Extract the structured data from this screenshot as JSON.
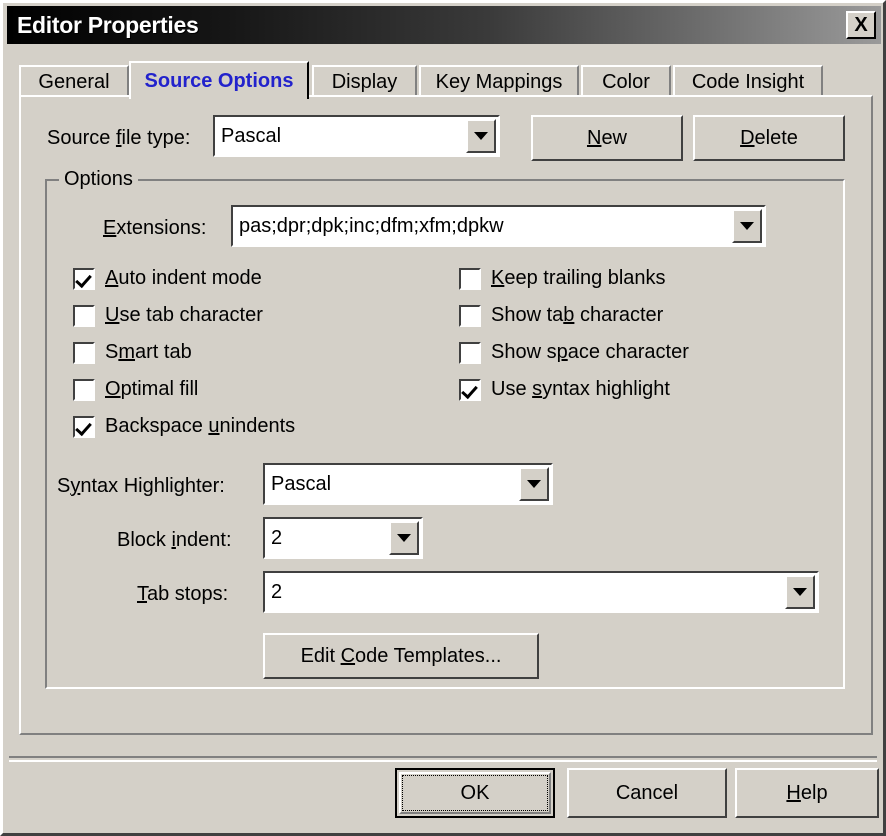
{
  "window": {
    "title": "Editor Properties",
    "close_label": "X",
    "titlebar_gradient_from": "#000000",
    "titlebar_gradient_to": "#9a9a9a",
    "face_color": "#d4d0c8",
    "active_tab_color": "#2222cc"
  },
  "tabs": [
    {
      "label": "General",
      "active": false
    },
    {
      "label": "Source Options",
      "active": true
    },
    {
      "label": "Display",
      "active": false
    },
    {
      "label": "Key Mappings",
      "active": false
    },
    {
      "label": "Color",
      "active": false
    },
    {
      "label": "Code Insight",
      "active": false
    }
  ],
  "source_file_type": {
    "label_pre": "Source ",
    "label_accel": "f",
    "label_post": "ile type:",
    "value": "Pascal"
  },
  "new_button": {
    "pre": "",
    "accel": "N",
    "post": "ew"
  },
  "delete_button": {
    "pre": "",
    "accel": "D",
    "post": "elete"
  },
  "groupbox": {
    "label": "Options"
  },
  "extensions": {
    "label_pre": "",
    "label_accel": "E",
    "label_post": "xtensions:",
    "value": "pas;dpr;dpk;inc;dfm;xfm;dpkw"
  },
  "checkboxes_left": [
    {
      "pre": "",
      "accel": "A",
      "post": "uto indent mode",
      "checked": true
    },
    {
      "pre": "",
      "accel": "U",
      "post": "se tab character",
      "checked": false
    },
    {
      "pre": "S",
      "accel": "m",
      "post": "art tab",
      "checked": false
    },
    {
      "pre": "",
      "accel": "O",
      "post": "ptimal fill",
      "checked": false
    },
    {
      "pre": "Backspace ",
      "accel": "u",
      "post": "nindents",
      "checked": true
    }
  ],
  "checkboxes_right": [
    {
      "pre": "",
      "accel": "K",
      "post": "eep trailing blanks",
      "checked": false
    },
    {
      "pre": "Show ta",
      "accel": "b",
      "post": " character",
      "checked": false
    },
    {
      "pre": "Show s",
      "accel": "p",
      "post": "ace character",
      "checked": false
    },
    {
      "pre": "Use ",
      "accel": "s",
      "post": "yntax highlight",
      "checked": true
    }
  ],
  "syntax_highlighter": {
    "label_pre": "S",
    "label_accel": "y",
    "label_post": "ntax Highlighter:",
    "value": "Pascal"
  },
  "block_indent": {
    "label_pre": "Block ",
    "label_accel": "i",
    "label_post": "ndent:",
    "value": "2"
  },
  "tab_stops": {
    "label_pre": "",
    "label_accel": "T",
    "label_post": "ab stops:",
    "value": "2"
  },
  "edit_code_templates": {
    "pre": "Edit ",
    "accel": "C",
    "post": "ode Templates..."
  },
  "ok_button": {
    "label": "OK"
  },
  "cancel_button": {
    "label": "Cancel"
  },
  "help_button": {
    "pre": "",
    "accel": "H",
    "post": "elp"
  }
}
